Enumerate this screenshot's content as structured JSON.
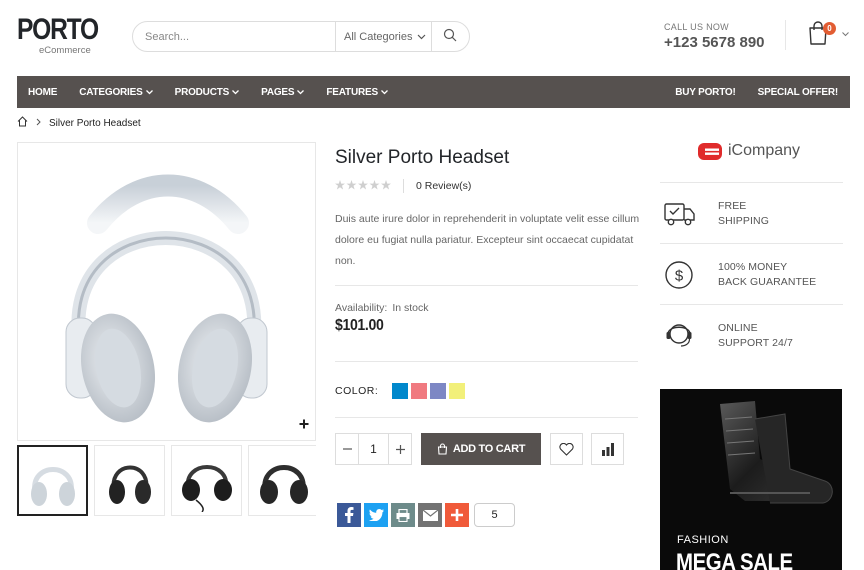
{
  "logo": {
    "main": "PORTO",
    "sub": "eCommerce"
  },
  "search": {
    "placeholder": "Search...",
    "category": "All Categories"
  },
  "contact": {
    "label": "CALL US NOW",
    "phone": "+123 5678 890"
  },
  "cart": {
    "count": "0"
  },
  "nav": {
    "items": [
      {
        "label": "HOME",
        "dropdown": false
      },
      {
        "label": "CATEGORIES",
        "dropdown": true
      },
      {
        "label": "PRODUCTS",
        "dropdown": true
      },
      {
        "label": "PAGES",
        "dropdown": true
      },
      {
        "label": "FEATURES",
        "dropdown": true
      }
    ],
    "right_items": [
      {
        "label": "BUY PORTO!"
      },
      {
        "label": "SPECIAL OFFER!"
      }
    ]
  },
  "breadcrumb": {
    "current": "Silver Porto Headset"
  },
  "product": {
    "title": "Silver Porto Headset",
    "reviews": "0 Review(s)",
    "rating": 0,
    "description": "Duis aute irure dolor in reprehenderit in voluptate velit esse cillum dolore eu fugiat nulla pariatur. Excepteur sint occaecat cupidatat non.",
    "availability_label": "Availability:",
    "availability_value": "In stock",
    "price": "$101.00",
    "color_label": "COLOR:",
    "colors": [
      "#0188cc",
      "#f07a80",
      "#7d87c4",
      "#f2f07a"
    ],
    "quantity": "1",
    "add_to_cart": "ADD TO CART",
    "share_count": "5"
  },
  "sidebar": {
    "brand": "iCompany",
    "brand_color": "#e02b2b",
    "features": [
      {
        "icon": "truck-icon",
        "line1": "FREE",
        "line2": "SHIPPING"
      },
      {
        "icon": "dollar-icon",
        "line1": "100% MONEY",
        "line2": "BACK GUARANTEE"
      },
      {
        "icon": "support-icon",
        "line1": "ONLINE",
        "line2": "SUPPORT 24/7"
      }
    ],
    "banner": {
      "label": "FASHION",
      "title": "MEGA SALE"
    }
  },
  "colors": {
    "nav_bg": "#56514f",
    "badge": "#e25d33",
    "facebook": "#3b5998",
    "twitter": "#1da1f2",
    "print": "#6d8b8a",
    "email": "#737373",
    "more": "#f05a3a"
  }
}
